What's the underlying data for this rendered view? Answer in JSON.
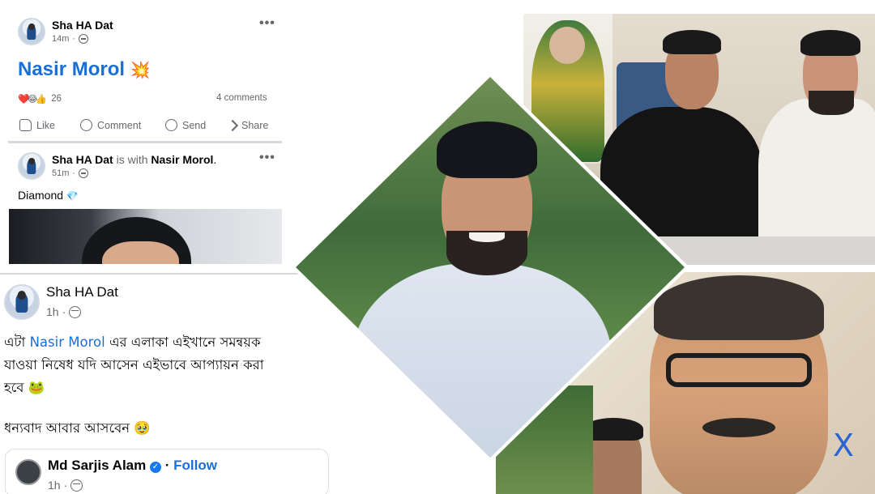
{
  "post1": {
    "author": "Sha HA Dat",
    "time": "14m",
    "headline": "Nasir Morol",
    "headline_emoji": "💥",
    "reaction_count": "26",
    "comments": "4 comments",
    "actions": [
      "Like",
      "Comment",
      "Send",
      "Share"
    ]
  },
  "post2": {
    "author": "Sha HA Dat",
    "with_text": "is with",
    "tagged": "Nasir Morol",
    "period": ".",
    "time": "51m",
    "body": "Diamond",
    "emoji": "💎"
  },
  "post3": {
    "author": "Sha HA Dat",
    "time": "1h",
    "line1_prefix": "এটা",
    "line1_link": "Nasir Morol",
    "line1_suffix": "এর এলাকা এইখানে সমন্বয়ক",
    "line2": "যাওয়া নিষেধ যদি আসেন এইভাবে আপ্যায়ন করা",
    "line3": "হবে",
    "line3_emoji": "🐸",
    "line4": "ধন্যবাদ আবার আসবেন",
    "line4_emoji": "🥹"
  },
  "embedded": {
    "author": "Md Sarjis Alam",
    "follow": "Follow",
    "time": "1h"
  },
  "overlay_close": "X",
  "colors": {
    "accent_blue": "#1a6ed8",
    "meta_gray": "#65676b",
    "close_blue": "#2a63d6"
  }
}
